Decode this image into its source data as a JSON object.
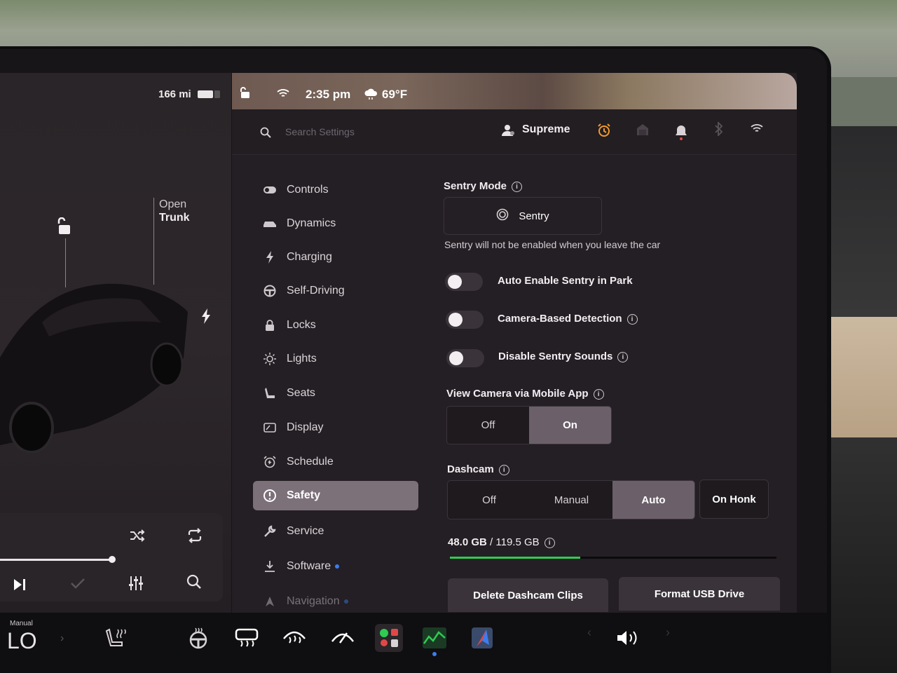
{
  "status": {
    "range": "166 mi",
    "time": "2:35 pm",
    "temperature": "69°F"
  },
  "car": {
    "trunk_line1": "Open",
    "trunk_line2": "Trunk"
  },
  "header": {
    "search_placeholder": "Search Settings",
    "profile_name": "Supreme"
  },
  "menu": {
    "items": [
      {
        "label": "Controls",
        "icon": "toggle-icon"
      },
      {
        "label": "Dynamics",
        "icon": "car-icon"
      },
      {
        "label": "Charging",
        "icon": "bolt-icon"
      },
      {
        "label": "Self-Driving",
        "icon": "steering-wheel-icon"
      },
      {
        "label": "Locks",
        "icon": "lock-icon"
      },
      {
        "label": "Lights",
        "icon": "sun-icon"
      },
      {
        "label": "Seats",
        "icon": "seat-icon"
      },
      {
        "label": "Display",
        "icon": "display-icon"
      },
      {
        "label": "Schedule",
        "icon": "alarm-clock-icon"
      },
      {
        "label": "Safety",
        "icon": "alert-circle-icon",
        "active": true
      },
      {
        "label": "Service",
        "icon": "wrench-icon"
      },
      {
        "label": "Software",
        "icon": "download-icon",
        "badge": true
      },
      {
        "label": "Navigation",
        "icon": "navigation-icon",
        "badge": true
      }
    ]
  },
  "safety": {
    "sentry_title": "Sentry Mode",
    "sentry_button": "Sentry",
    "sentry_note": "Sentry will not be enabled when you leave the car",
    "auto_enable": "Auto Enable Sentry in Park",
    "camera_detection": "Camera-Based Detection",
    "disable_sounds": "Disable Sentry Sounds",
    "view_camera_title": "View Camera via Mobile App",
    "view_camera_options": [
      "Off",
      "On"
    ],
    "view_camera_selected": "On",
    "dashcam_title": "Dashcam",
    "dashcam_options": [
      "Off",
      "Manual",
      "Auto"
    ],
    "dashcam_selected": "Auto",
    "on_honk": "On Honk",
    "storage_used": "48.0 GB",
    "storage_total": "/ 119.5 GB",
    "storage_fraction": 0.4,
    "delete_clips": "Delete Dashcam Clips",
    "format_usb": "Format USB Drive"
  },
  "dock": {
    "drive_mode_label": "Manual",
    "drive_mode_value": "LO"
  },
  "colors": {
    "accent_green": "#2ecc52",
    "badge_blue": "#3c7df0",
    "alarm_orange": "#f39a2b"
  }
}
